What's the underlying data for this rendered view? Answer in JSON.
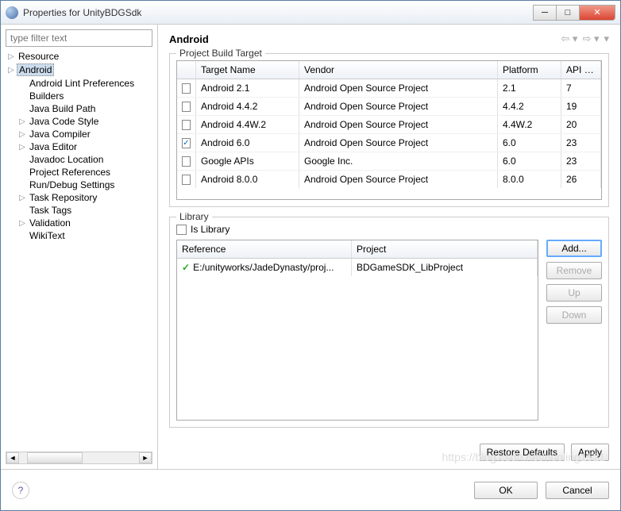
{
  "window": {
    "title": "Properties for UnityBDGSdk"
  },
  "filter_placeholder": "type filter text",
  "tree": [
    {
      "label": "Resource",
      "arrow": true,
      "selected": false
    },
    {
      "label": "Android",
      "arrow": true,
      "selected": true
    },
    {
      "label": "Android Lint Preferences",
      "arrow": false,
      "indent": true
    },
    {
      "label": "Builders",
      "arrow": false,
      "indent": true
    },
    {
      "label": "Java Build Path",
      "arrow": false,
      "indent": true
    },
    {
      "label": "Java Code Style",
      "arrow": true,
      "indent": true
    },
    {
      "label": "Java Compiler",
      "arrow": true,
      "indent": true
    },
    {
      "label": "Java Editor",
      "arrow": true,
      "indent": true
    },
    {
      "label": "Javadoc Location",
      "arrow": false,
      "indent": true
    },
    {
      "label": "Project References",
      "arrow": false,
      "indent": true
    },
    {
      "label": "Run/Debug Settings",
      "arrow": false,
      "indent": true
    },
    {
      "label": "Task Repository",
      "arrow": true,
      "indent": true
    },
    {
      "label": "Task Tags",
      "arrow": false,
      "indent": true
    },
    {
      "label": "Validation",
      "arrow": true,
      "indent": true
    },
    {
      "label": "WikiText",
      "arrow": false,
      "indent": true
    }
  ],
  "page_title": "Android",
  "build_target": {
    "title": "Project Build Target",
    "headers": {
      "name": "Target Name",
      "vendor": "Vendor",
      "platform": "Platform",
      "api": "API L..."
    },
    "rows": [
      {
        "checked": false,
        "name": "Android 2.1",
        "vendor": "Android Open Source Project",
        "platform": "2.1",
        "api": "7"
      },
      {
        "checked": false,
        "name": "Android 4.4.2",
        "vendor": "Android Open Source Project",
        "platform": "4.4.2",
        "api": "19"
      },
      {
        "checked": false,
        "name": "Android 4.4W.2",
        "vendor": "Android Open Source Project",
        "platform": "4.4W.2",
        "api": "20"
      },
      {
        "checked": true,
        "name": "Android 6.0",
        "vendor": "Android Open Source Project",
        "platform": "6.0",
        "api": "23"
      },
      {
        "checked": false,
        "name": "Google APIs",
        "vendor": "Google Inc.",
        "platform": "6.0",
        "api": "23"
      },
      {
        "checked": false,
        "name": "Android 8.0.0",
        "vendor": "Android Open Source Project",
        "platform": "8.0.0",
        "api": "26"
      }
    ]
  },
  "library": {
    "title": "Library",
    "is_library_label": "Is Library",
    "is_library_checked": false,
    "headers": {
      "ref": "Reference",
      "proj": "Project"
    },
    "rows": [
      {
        "ref": "E:/unityworks/JadeDynasty/proj...",
        "proj": "BDGameSDK_LibProject"
      }
    ],
    "buttons": {
      "add": "Add...",
      "remove": "Remove",
      "up": "Up",
      "down": "Down"
    }
  },
  "actions": {
    "restore": "Restore Defaults",
    "apply": "Apply",
    "ok": "OK",
    "cancel": "Cancel"
  },
  "watermark": "https://blog.csdn.net/huoling1521"
}
